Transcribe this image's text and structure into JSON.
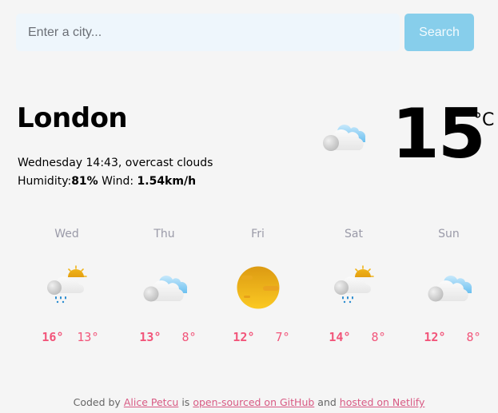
{
  "search": {
    "placeholder": "Enter a city...",
    "value": "",
    "button_label": "Search"
  },
  "current": {
    "city": "London",
    "day_time": "Wednesday 14:43",
    "description": "overcast clouds",
    "humidity_label": "Humidity:",
    "humidity": "81%",
    "wind_label": "Wind:",
    "wind": "1.54km/h",
    "temperature": "15",
    "unit": "°C",
    "icon": "overcast-clouds-icon"
  },
  "forecast": [
    {
      "day": "Wed",
      "icon": "rain-sun-cloud-icon",
      "max": "16°",
      "min": "13°"
    },
    {
      "day": "Thu",
      "icon": "cloud-icon",
      "max": "13°",
      "min": "8°"
    },
    {
      "day": "Fri",
      "icon": "sun-icon",
      "max": "12°",
      "min": "7°"
    },
    {
      "day": "Sat",
      "icon": "rain-sun-cloud-icon",
      "max": "14°",
      "min": "8°"
    },
    {
      "day": "Sun",
      "icon": "cloud-icon",
      "max": "12°",
      "min": "8°"
    }
  ],
  "footer": {
    "prefix": "Coded by",
    "author": "Alice Petcu",
    "mid1": "is",
    "github": "open-sourced on GitHub",
    "mid2": "and",
    "netlify": "hosted on Netlify"
  },
  "colors": {
    "background": "#f5f5f5",
    "search_button": "#87ceeb",
    "input_bg": "#eef6fc",
    "temp_accent": "#f2557a",
    "link": "#d85a84"
  }
}
